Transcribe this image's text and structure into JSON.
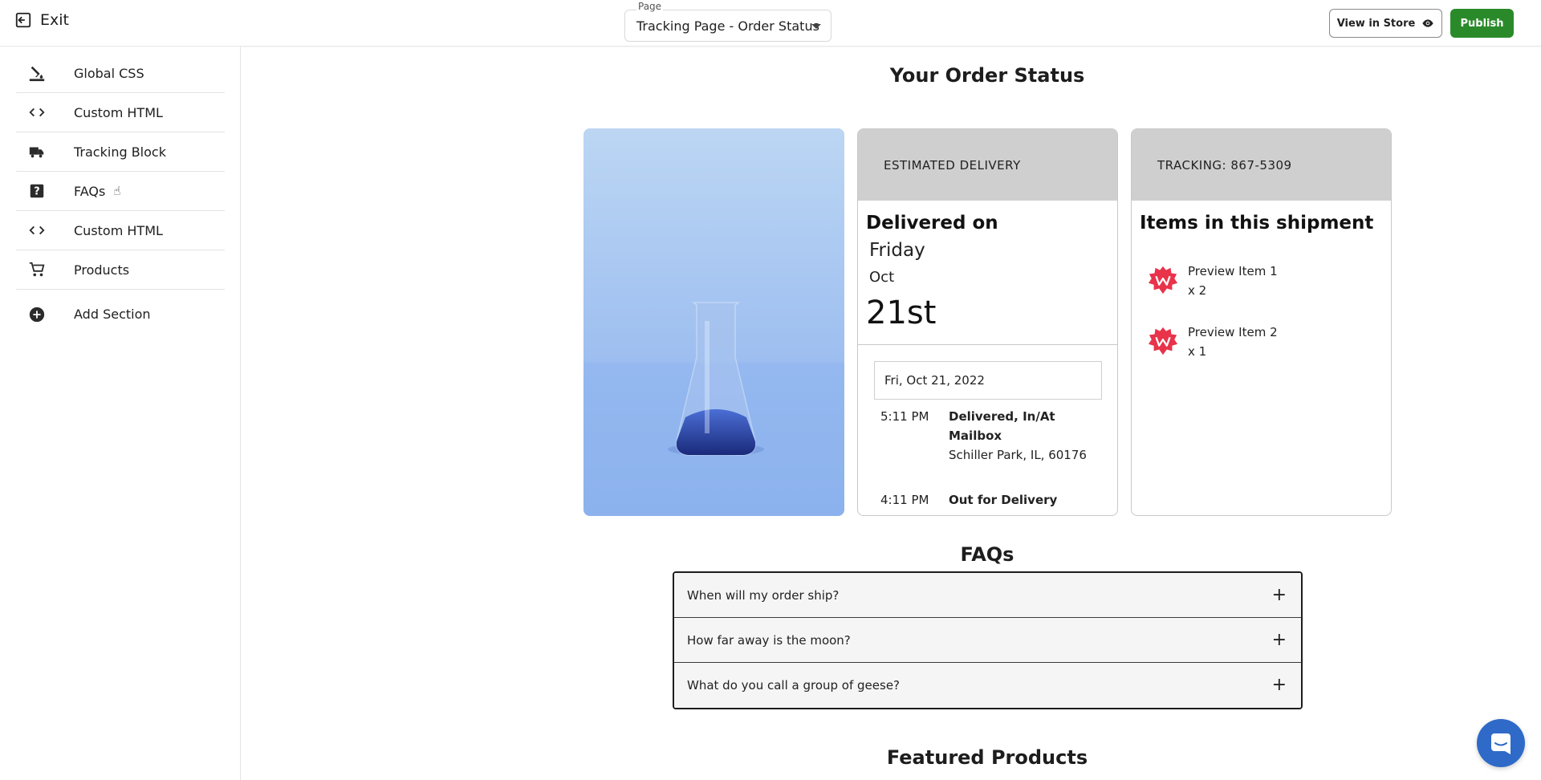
{
  "topbar": {
    "exit_label": "Exit",
    "page_caption": "Page",
    "page_value": "Tracking Page - Order Status",
    "view_in_store_label": "View in Store",
    "publish_label": "Publish"
  },
  "sidebar": {
    "items": [
      {
        "label": "Global CSS",
        "icon": "paint-bucket-icon"
      },
      {
        "label": "Custom HTML",
        "icon": "code-icon"
      },
      {
        "label": "Tracking Block",
        "icon": "truck-icon"
      },
      {
        "label": "FAQs",
        "icon": "question-icon"
      },
      {
        "label": "Custom HTML",
        "icon": "code-icon"
      },
      {
        "label": "Products",
        "icon": "cart-icon"
      },
      {
        "label": "Add Section",
        "icon": "add-circle-icon"
      }
    ]
  },
  "main": {
    "title": "Your Order Status",
    "delivery": {
      "header": "ESTIMATED DELIVERY",
      "label": "Delivered on",
      "day": "Friday",
      "month": "Oct",
      "date": "21st",
      "date_box": "Fri, Oct 21, 2022",
      "events": [
        {
          "time": "5:11 PM",
          "status": "Delivered, In/At Mailbox",
          "location": "Schiller Park, IL, 60176"
        },
        {
          "time": "4:11 PM",
          "status": "Out for Delivery",
          "location": ""
        }
      ]
    },
    "shipment": {
      "header": "TRACKING: 867-5309",
      "title": "Items in this shipment",
      "items": [
        {
          "name": "Preview Item 1",
          "qty": "x 2"
        },
        {
          "name": "Preview Item 2",
          "qty": "x 1"
        }
      ]
    },
    "faqs": {
      "title": "FAQs",
      "questions": [
        "When will my order ship?",
        "How far away is the moon?",
        "What do you call a group of geese?"
      ]
    },
    "featured_title": "Featured Products"
  },
  "colors": {
    "publish": "#2a8a2a",
    "chat": "#2f6ac8",
    "card_header": "#cfcfcf",
    "product_logo": "#e8334a"
  }
}
